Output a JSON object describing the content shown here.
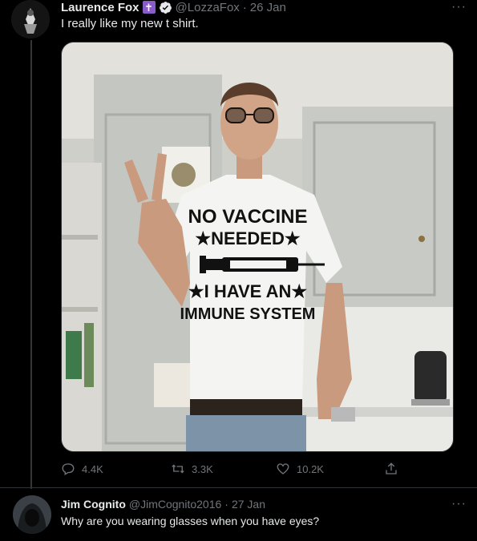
{
  "tweet": {
    "author_name": "Laurence Fox",
    "author_handle": "@LozzaFox",
    "separator": "·",
    "date": "26 Jan",
    "text": "I really like my new t shirt.",
    "badge_cross": "✝",
    "photo": {
      "shirt_line1": "NO VACCINE",
      "shirt_line2": "★NEEDED★",
      "shirt_line3": "★I HAVE AN★",
      "shirt_line4": "IMMUNE SYSTEM"
    },
    "stats": {
      "replies": "4.4K",
      "retweets": "3.3K",
      "likes": "10.2K"
    }
  },
  "reply": {
    "author_name": "Jim Cognito",
    "author_handle": "@JimCognito2016",
    "separator": "·",
    "date": "27 Jan",
    "text": "Why are you wearing glasses when you have eyes?"
  },
  "colors": {
    "background": "#000000",
    "text_primary": "#e7e9ea",
    "text_secondary": "#71767b",
    "verified_blue": "#1d9bf0",
    "cross_badge": "#8a5cc9"
  }
}
